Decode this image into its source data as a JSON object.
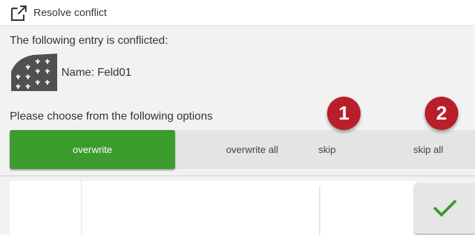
{
  "window": {
    "title": "Resolve conflict",
    "title_icon": "external-link-icon"
  },
  "conflict": {
    "heading": "The following entry is conflicted:",
    "entry_icon": "field-icon",
    "entry_name": "Name: Feld01"
  },
  "options": {
    "heading": "Please choose from the following options",
    "items": [
      {
        "label": "overwrite",
        "selected": true
      },
      {
        "label": "overwrite all",
        "selected": false
      },
      {
        "label": "skip",
        "selected": false
      },
      {
        "label": "skip all",
        "selected": false
      }
    ]
  },
  "badges": [
    "1",
    "2"
  ],
  "confirm": {
    "icon": "checkmark-icon"
  },
  "colors": {
    "selected": "#3c9b2d",
    "badge": "#b81f2a",
    "checkmark": "#3c9b2d"
  }
}
